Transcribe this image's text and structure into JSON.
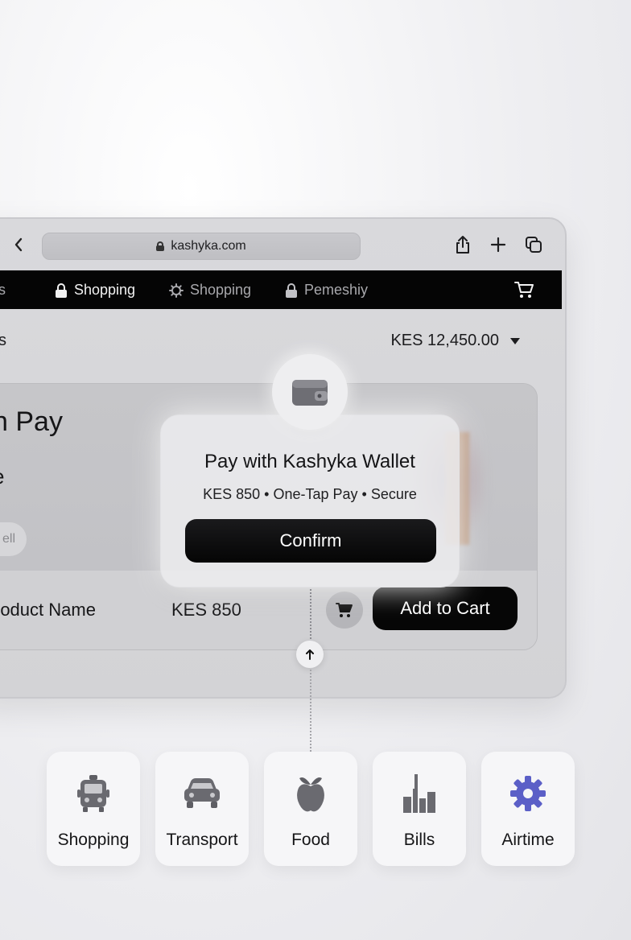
{
  "browser": {
    "url": "kashyka.com"
  },
  "navbar": {
    "items": [
      {
        "label": "ilas",
        "icon": "none"
      },
      {
        "label": "Shopping",
        "icon": "lock-icon"
      },
      {
        "label": "Shopping",
        "icon": "gear-icon"
      },
      {
        "label": "Pemeshiy",
        "icon": "lock-icon"
      }
    ]
  },
  "header": {
    "left_text": "s",
    "balance": "KES 12,450.00"
  },
  "hero": {
    "title": "n Pay",
    "subtitle": "e",
    "chip": "ell"
  },
  "product": {
    "name": "roduct Name",
    "price": "KES 850",
    "add_to_cart": "Add to Cart"
  },
  "modal": {
    "title": "Pay with Kashyka Wallet",
    "details": "KES 850 • One-Tap Pay • Secure",
    "confirm": "Confirm"
  },
  "categories": [
    {
      "label": "Shopping",
      "icon": "bus-icon"
    },
    {
      "label": "Transport",
      "icon": "car-icon"
    },
    {
      "label": "Food",
      "icon": "apple-icon"
    },
    {
      "label": "Bills",
      "icon": "bar-chart-icon"
    },
    {
      "label": "Airtime",
      "icon": "gear-icon"
    }
  ],
  "colors": {
    "navbar_bg": "#050505",
    "button_bg": "#060606",
    "airtime_icon": "#5b5fc7"
  }
}
